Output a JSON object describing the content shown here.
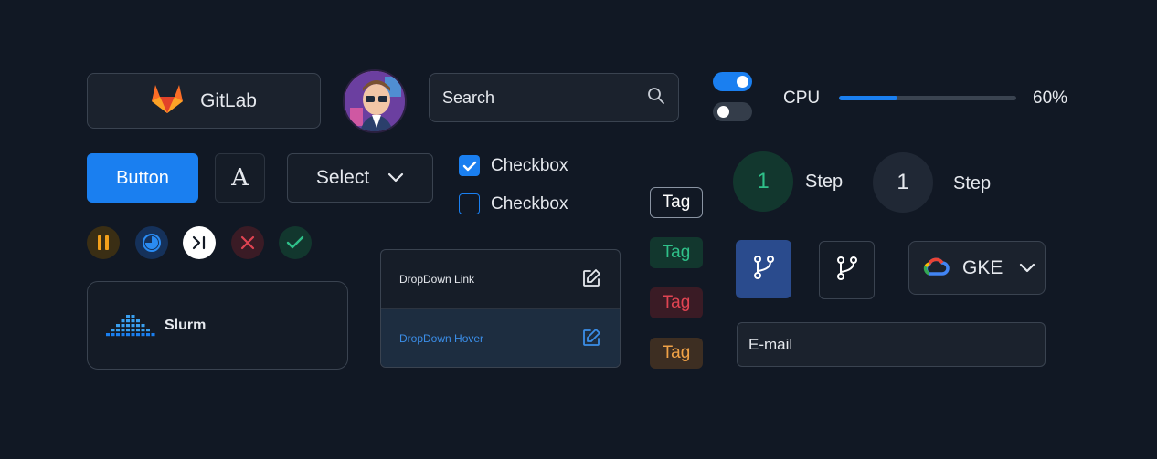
{
  "gitlab_button": {
    "label": "GitLab",
    "icon": "gitlab-logo"
  },
  "avatar": {
    "icon": "avatar-illustration"
  },
  "search": {
    "placeholder": "Search",
    "icon": "search-icon"
  },
  "toggles": [
    {
      "state": "on"
    },
    {
      "state": "off"
    }
  ],
  "cpu": {
    "label": "CPU",
    "value_text": "60%",
    "value": 0.33
  },
  "primary_button": {
    "label": "Button"
  },
  "font_button": {
    "label": "A"
  },
  "select": {
    "label": "Select",
    "icon": "chevron-down-icon"
  },
  "checkboxes": [
    {
      "label": "Checkbox",
      "checked": true
    },
    {
      "label": "Checkbox",
      "checked": false
    }
  ],
  "tags": [
    {
      "label": "Tag",
      "variant": "default",
      "color": "#ffffff",
      "bg": "#111824",
      "border": "#8a94a3"
    },
    {
      "label": "Tag",
      "variant": "success",
      "color": "#2fc089",
      "bg": "#12372e"
    },
    {
      "label": "Tag",
      "variant": "danger",
      "color": "#e04452",
      "bg": "#3a1b25"
    },
    {
      "label": "Tag",
      "variant": "warning",
      "color": "#f1a247",
      "bg": "#3d2e22"
    }
  ],
  "status_icons": [
    {
      "icon": "pause-icon",
      "color": "#f3a01b",
      "bg": "#3a2e14"
    },
    {
      "icon": "progress-icon",
      "color": "#2a8bf2",
      "bg": "#15315a"
    },
    {
      "icon": "skip-next-icon",
      "color": "#111824",
      "bg": "#ffffff"
    },
    {
      "icon": "close-icon",
      "color": "#e04452",
      "bg": "#3a1b25"
    },
    {
      "icon": "check-icon",
      "color": "#2fc089",
      "bg": "#12372e"
    }
  ],
  "slurm": {
    "label": "Slurm",
    "icon": "slurm-logo"
  },
  "dropdown": {
    "items": [
      {
        "label": "DropDown Link",
        "icon": "edit-icon",
        "state": "default"
      },
      {
        "label": "DropDown Hover",
        "icon": "edit-icon",
        "state": "hover"
      }
    ]
  },
  "steps": [
    {
      "number": "1",
      "label": "Step",
      "state": "active"
    },
    {
      "number": "1",
      "label": "Step",
      "state": "inactive"
    }
  ],
  "branch_buttons": [
    {
      "icon": "git-branch-icon",
      "state": "active"
    },
    {
      "icon": "git-branch-icon",
      "state": "default"
    }
  ],
  "gke": {
    "label": "GKE",
    "icon": "google-cloud-icon",
    "chevron": "chevron-down-icon"
  },
  "email": {
    "placeholder": "E-mail"
  },
  "colors": {
    "accent": "#1a7ff0",
    "background": "#111824",
    "surface": "#1b222d",
    "border": "#3a4350"
  }
}
